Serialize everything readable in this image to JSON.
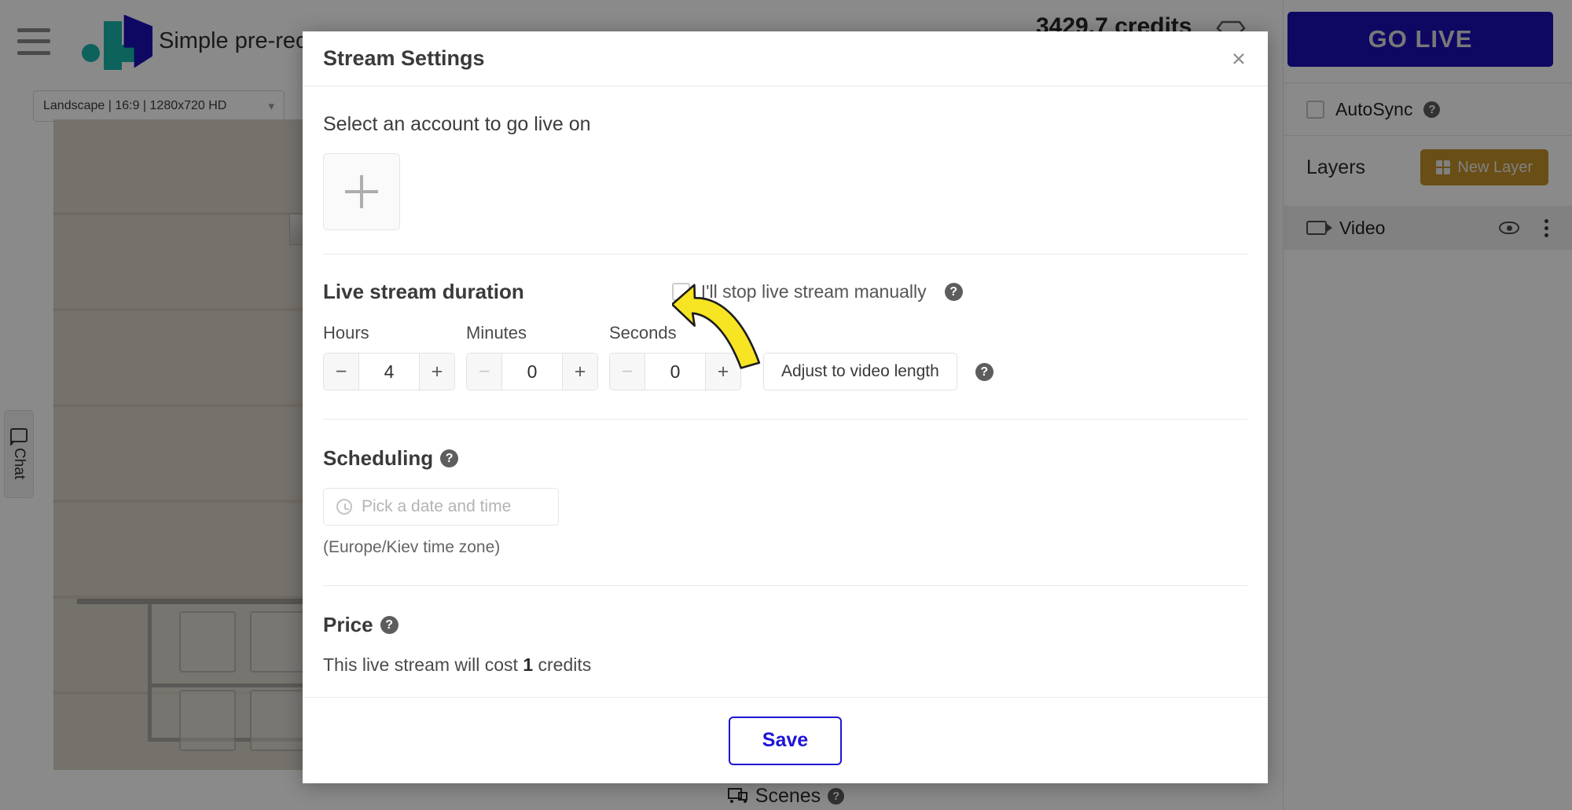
{
  "app": {
    "title": "Simple pre-recorded",
    "credits": "3429.7 credits",
    "format_select": "Landscape | 16:9 | 1280x720 HD",
    "format_chevron": "chevron-down-icon",
    "menu_icon": "hamburger-menu-icon",
    "logo": "logo-icon",
    "chat_tab": "Chat",
    "scenes_label": "Scenes",
    "scenes_help": "?"
  },
  "right_panel": {
    "go_live": "GO LIVE",
    "autosync": "AutoSync",
    "autosync_help": "?",
    "autosync_checked": false,
    "layers_title": "Layers",
    "new_layer": "New Layer",
    "layers": [
      {
        "name": "Video",
        "visible": true
      }
    ]
  },
  "modal": {
    "title": "Stream Settings",
    "close": "×",
    "account": {
      "label": "Select an account to go live on",
      "add_tile": "add-account-tile"
    },
    "duration": {
      "title": "Live stream duration",
      "manual_stop_label": "I'll stop live stream manually",
      "manual_stop_checked": false,
      "manual_stop_help": "?",
      "fields": [
        {
          "label": "Hours",
          "value": "4",
          "minus_disabled": false
        },
        {
          "label": "Minutes",
          "value": "0",
          "minus_disabled": true
        },
        {
          "label": "Seconds",
          "value": "0",
          "minus_disabled": true
        }
      ],
      "minus": "−",
      "plus": "+",
      "adjust_button": "Adjust to video length",
      "adjust_help": "?"
    },
    "scheduling": {
      "title": "Scheduling",
      "help": "?",
      "date_placeholder": "Pick a date and time",
      "date_value": "",
      "timezone": "(Europe/Kiev time zone)"
    },
    "price": {
      "title": "Price",
      "help": "?",
      "prefix": "This live stream will cost ",
      "amount": "1",
      "suffix": " credits"
    },
    "save": "Save"
  },
  "colors": {
    "brand_blue": "#1a0fb8",
    "brand_teal": "#19b5aa",
    "accent_orange": "#c3912a",
    "save_blue": "#1f14d6",
    "annotation_yellow": "#f7e422"
  }
}
